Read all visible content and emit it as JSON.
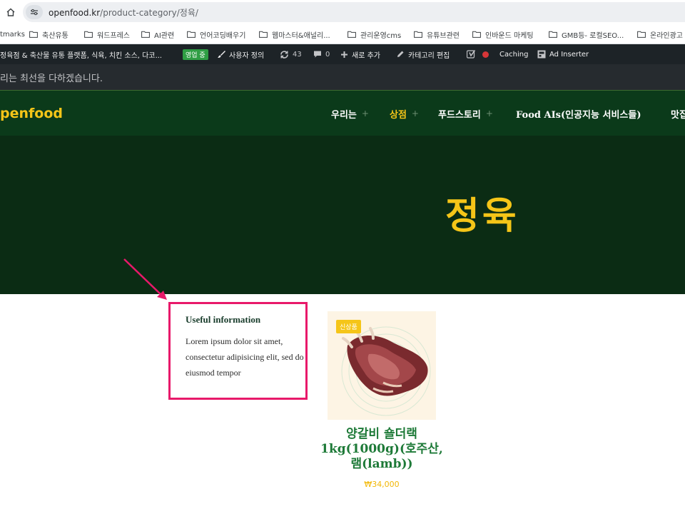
{
  "browser": {
    "url_host": "openfood.kr",
    "url_path": "/product-category/정육/"
  },
  "bookmarks": [
    {
      "label": "tmarks"
    },
    {
      "label": "축산유통"
    },
    {
      "label": "워드프레스"
    },
    {
      "label": "AI관련"
    },
    {
      "label": "언어코딩배우기"
    },
    {
      "label": "웹마스터&애널리..."
    },
    {
      "label": "관리운영cms"
    },
    {
      "label": "유튜브관련"
    },
    {
      "label": "인바운드 마케팅"
    },
    {
      "label": "GMB등- 로컬SEO..."
    },
    {
      "label": "온라인광고"
    }
  ],
  "adminbar": {
    "site_name": "정육점 & 축산물 유통 플랫폼, 식육, 치킨 소스, 다코...",
    "status_badge": "영업 중",
    "customize": "사용자 정의",
    "updates_count": "43",
    "comments_count": "0",
    "new_label": "새로 추가",
    "edit_category": "카테고리 편집",
    "caching": "Caching",
    "ad_inserter": "Ad Inserter"
  },
  "notice": "리는 최선을 다하겠습니다.",
  "header": {
    "logo": "penfood",
    "nav": [
      {
        "label": "우리는"
      },
      {
        "label": "상점"
      },
      {
        "label": "푸드스토리"
      },
      {
        "label": "Food AIs(인공지능 서비스들)"
      },
      {
        "label": "맛집"
      }
    ]
  },
  "hero": {
    "title": "정육"
  },
  "info_box": {
    "title": "Useful information",
    "text": "Lorem ipsum dolor sit amet, consectetur adipisicing elit, sed do eiusmod tempor"
  },
  "product": {
    "badge": "신상품",
    "name": "양갈비 숄더랙 1kg(1000g)(호주산, 램(lamb))",
    "price": "₩34,000"
  },
  "colors": {
    "header_bg": "#0b3a1a",
    "hero_bg": "#0b2c14",
    "accent_yellow": "#f5c518",
    "annotation_pink": "#e8196a",
    "product_green": "#1e7a38"
  }
}
